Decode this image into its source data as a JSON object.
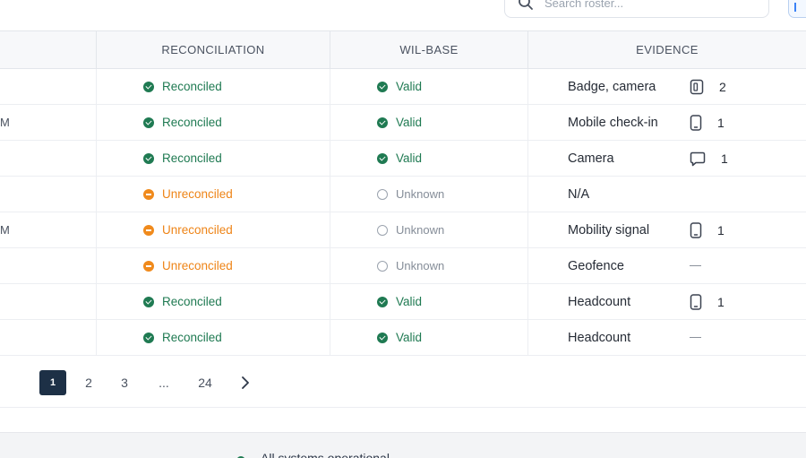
{
  "search": {
    "placeholder": "Search roster..."
  },
  "table": {
    "headers": [
      "RECONCILIATION",
      "WIL-BASE",
      "EVIDENCE"
    ],
    "rows": [
      {
        "partial": "",
        "reconciliation": "Reconciled",
        "status": "ok",
        "wil_base": "Valid",
        "wil_state": "ok",
        "evidence": "Badge, camera",
        "count": "2",
        "icon": "id-card-icon",
        "dash": false
      },
      {
        "partial": "M",
        "reconciliation": "Reconciled",
        "status": "ok",
        "wil_base": "Valid",
        "wil_state": "ok",
        "evidence": "Mobile check-in",
        "count": "1",
        "icon": "phone-icon",
        "dash": false
      },
      {
        "partial": "",
        "reconciliation": "Reconciled",
        "status": "ok",
        "wil_base": "Valid",
        "wil_state": "ok",
        "evidence": "Camera",
        "count": "1",
        "icon": "message-icon",
        "dash": false
      },
      {
        "partial": "",
        "reconciliation": "Unreconciled",
        "status": "warn",
        "wil_base": "Unknown",
        "wil_state": "unknown",
        "evidence": "N/A",
        "count": "",
        "icon": "",
        "dash": false
      },
      {
        "partial": "M",
        "reconciliation": "Unreconciled",
        "status": "warn",
        "wil_base": "Unknown",
        "wil_state": "unknown",
        "evidence": "Mobility signal",
        "count": "1",
        "icon": "phone-icon",
        "dash": false
      },
      {
        "partial": "",
        "reconciliation": "Unreconciled",
        "status": "warn",
        "wil_base": "Unknown",
        "wil_state": "unknown",
        "evidence": "Geofence",
        "count": "",
        "icon": "",
        "dash": true
      },
      {
        "partial": "",
        "reconciliation": "Reconciled",
        "status": "ok",
        "wil_base": "Valid",
        "wil_state": "ok",
        "evidence": "Headcount",
        "count": "1",
        "icon": "phone-icon",
        "dash": false
      },
      {
        "partial": "",
        "reconciliation": "Reconciled",
        "status": "ok",
        "wil_base": "Valid",
        "wil_state": "ok",
        "evidence": "Headcount",
        "count": "",
        "icon": "",
        "dash": true
      }
    ]
  },
  "pagination": {
    "pages": [
      "1",
      "2",
      "3",
      "...",
      "24"
    ],
    "current": "1"
  },
  "footer": {
    "status_text": "All systems operational"
  },
  "colors": {
    "green": "#1f7a52",
    "orange": "#ee8417",
    "active_page": "#1d3046"
  }
}
